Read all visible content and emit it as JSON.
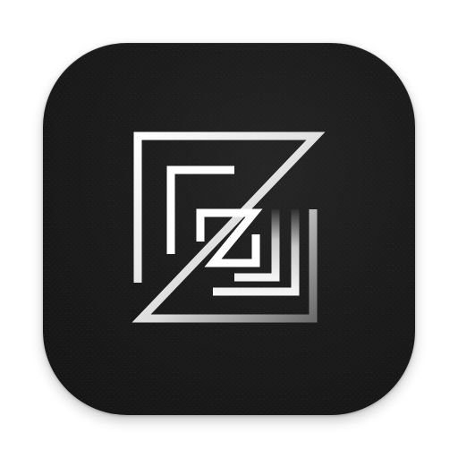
{
  "app_icon": {
    "icon": "maze-z-logo-icon",
    "background_color": "#1a1a1a",
    "glyph_color": "#ffffff"
  }
}
